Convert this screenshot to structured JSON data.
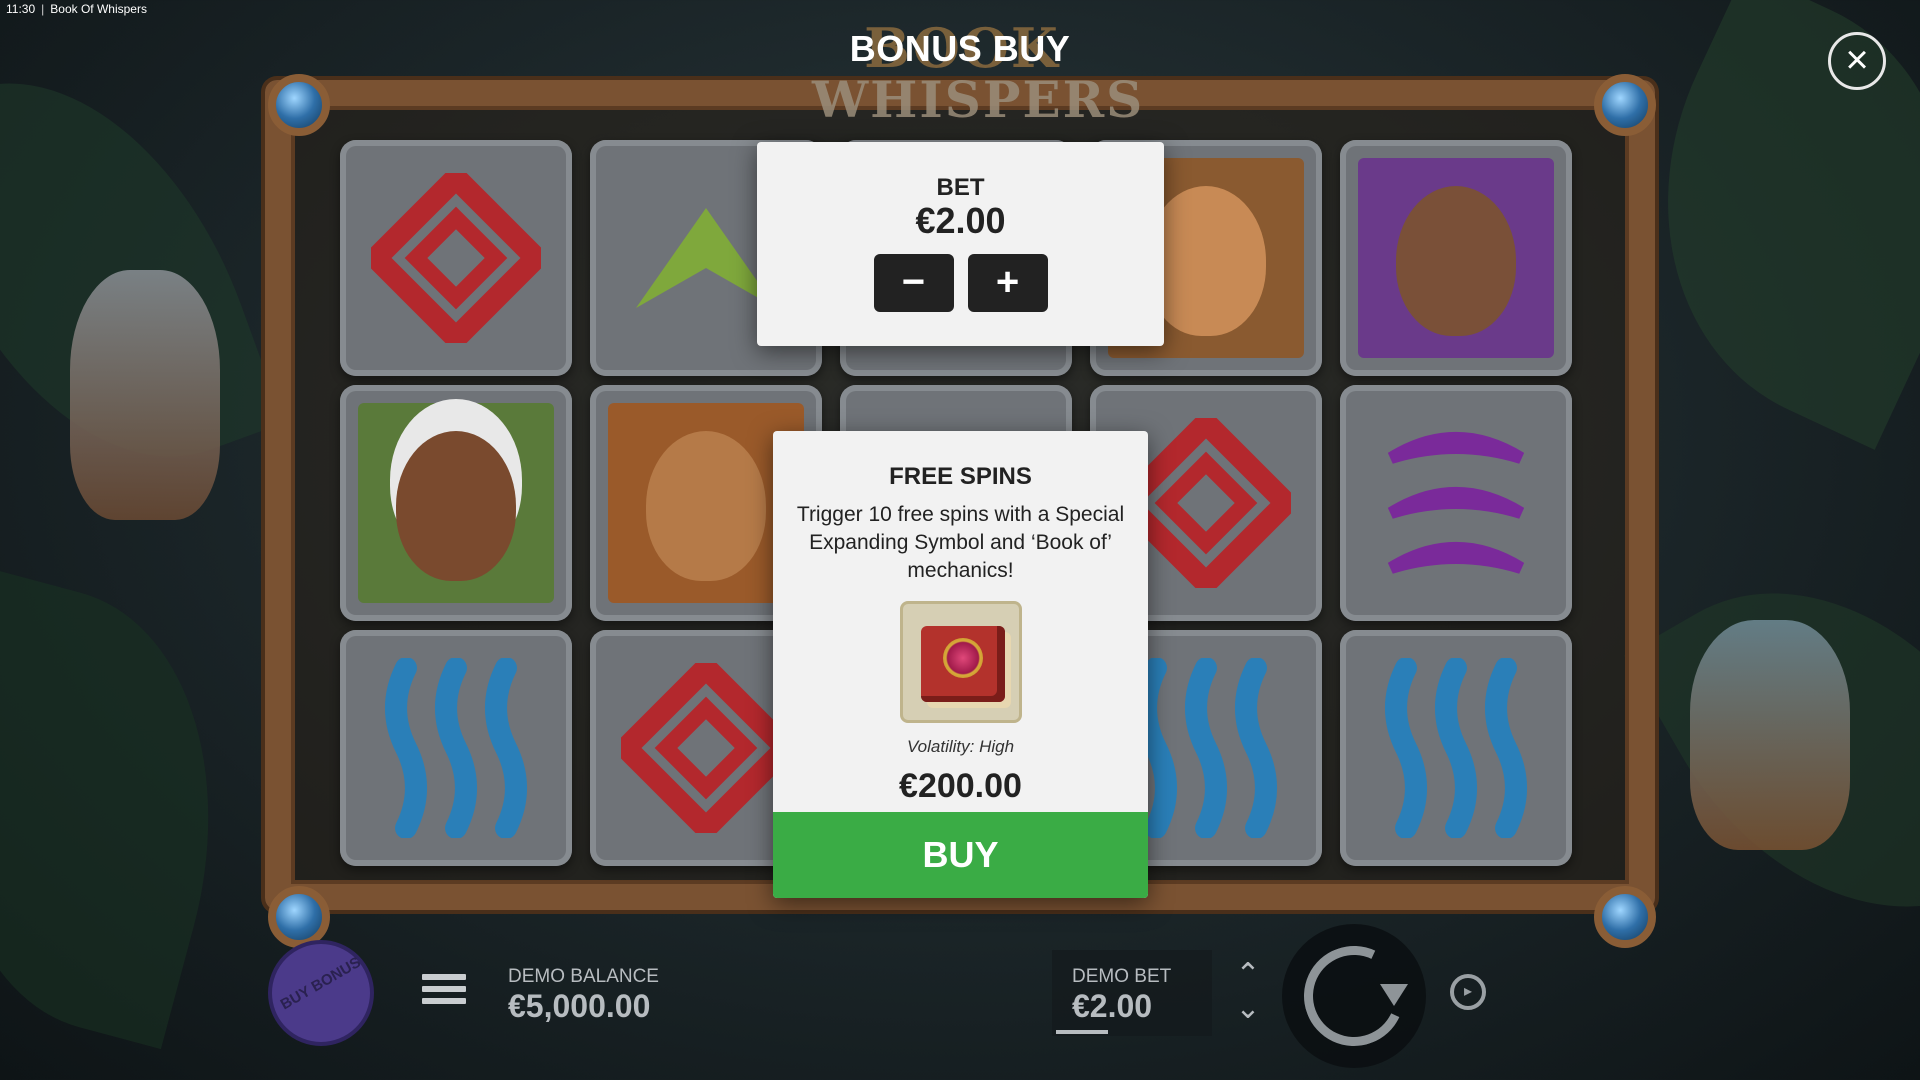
{
  "system": {
    "time": "11:30",
    "separator": "|",
    "app_title": "Book Of Whispers"
  },
  "logo": {
    "line1": "BOOK",
    "line2": "WHISPERS"
  },
  "overlay": {
    "title": "BONUS BUY",
    "close_icon": "close-icon"
  },
  "bet_panel": {
    "label": "BET",
    "value": "€2.00",
    "minus_label": "−",
    "plus_label": "+"
  },
  "free_spins_panel": {
    "title": "FREE SPINS",
    "description": "Trigger 10 free spins with a Special Expanding Symbol and ‘Book of’ mechanics!",
    "icon": "book-icon",
    "volatility": "Volatility: High",
    "price": "€200.00",
    "buy_label": "BUY"
  },
  "reels": {
    "rows": [
      [
        "red-spiral",
        "green-chevron",
        "",
        "woman-portrait",
        "purple-woman-portrait"
      ],
      [
        "elder-portrait",
        "woman-portrait",
        "",
        "red-spiral",
        "purple-chevrons"
      ],
      [
        "blue-waves",
        "red-spiral",
        "",
        "blue-waves",
        "blue-waves"
      ]
    ]
  },
  "controls": {
    "buy_bonus_label": "BUY BONUS",
    "demo_balance_label": "DEMO BALANCE",
    "demo_balance_value": "€5,000.00",
    "demo_bet_label": "DEMO BET",
    "demo_bet_value": "€2.00"
  },
  "colors": {
    "buy_green": "#3aac45",
    "panel_bg": "#f2f2f2",
    "frame_wood": "#7a5232"
  }
}
